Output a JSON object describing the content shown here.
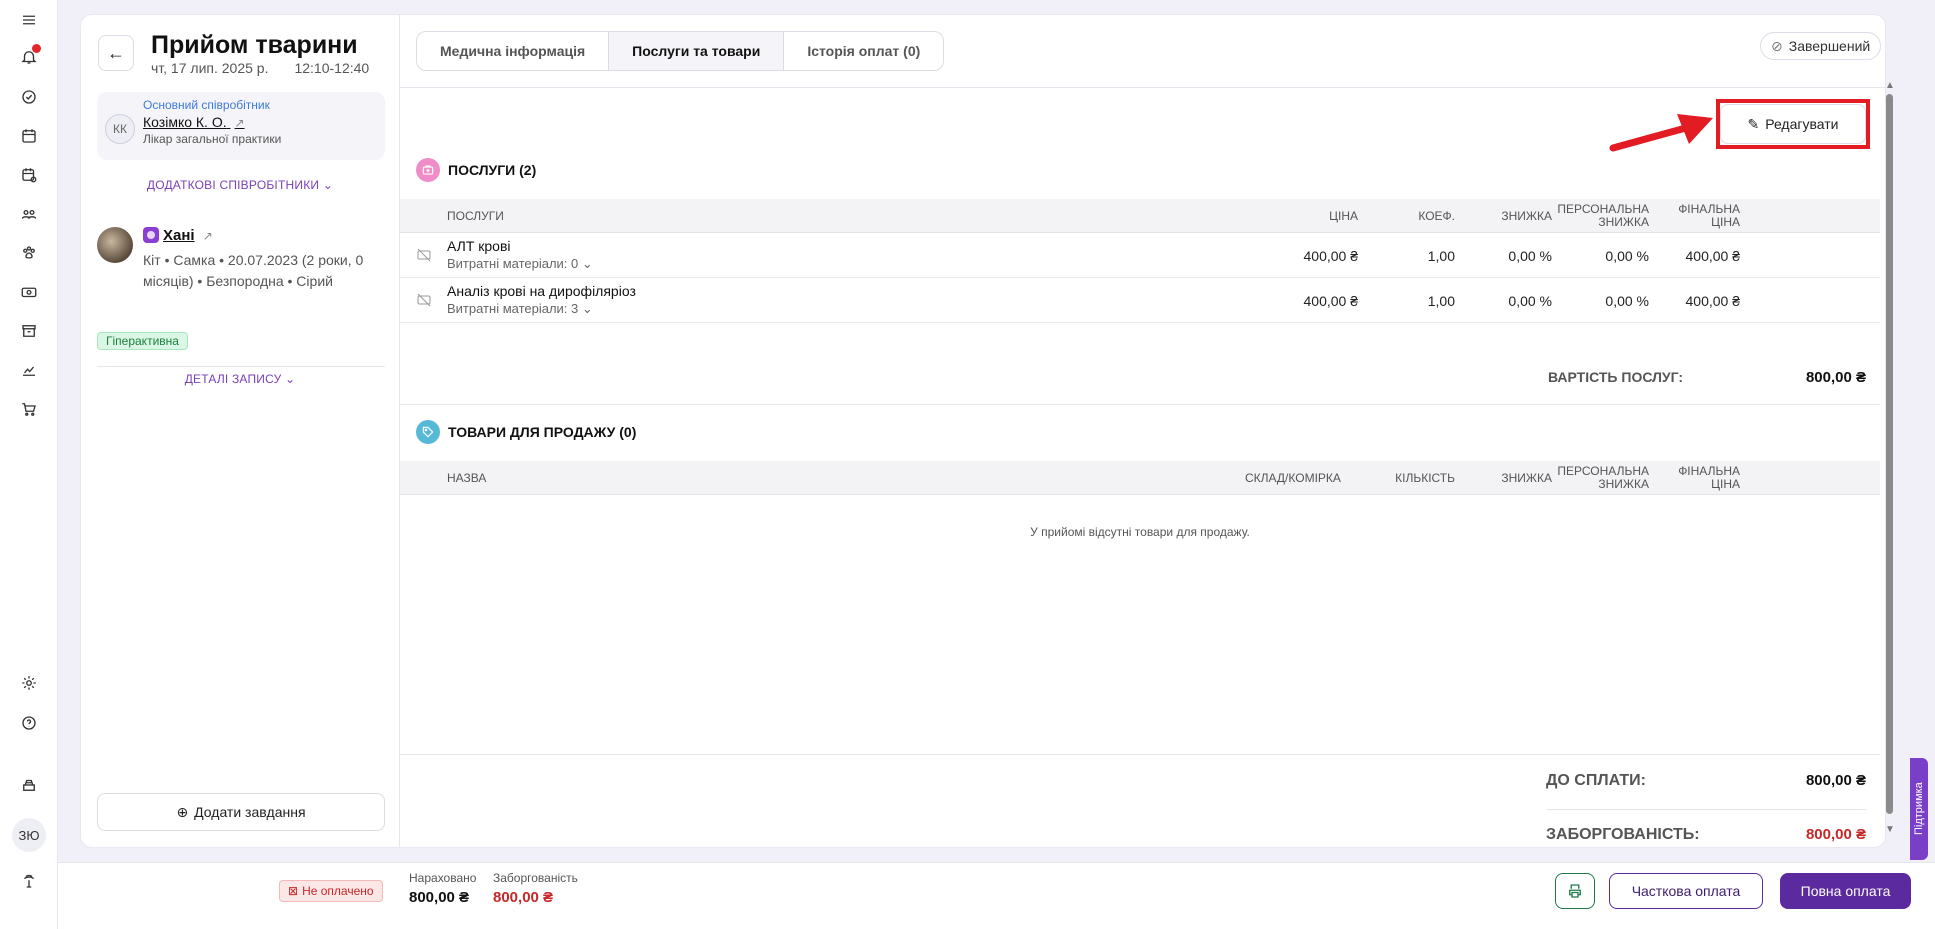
{
  "header": {
    "title": "Прийом тварини",
    "date": "чт, 17 лип. 2025 р.",
    "time": "12:10-12:40"
  },
  "staff": {
    "role_label": "Основний співробітник",
    "initials": "КК",
    "name": "Козімко К. О.",
    "position": "Лікар загальної практики",
    "additional_link": "ДОДАТКОВІ СПІВРОБІТНИКИ"
  },
  "pet": {
    "name": "Хані",
    "info": "Кіт • Самка • 20.07.2023 (2 роки, 0 місяців) • Безпородна • Сірий",
    "tag": "Гіперактивна",
    "details_link": "ДЕТАЛІ ЗАПИСУ"
  },
  "add_task_label": "Додати завдання",
  "tabs": [
    {
      "label": "Медична інформація"
    },
    {
      "label": "Послуги та товари"
    },
    {
      "label": "Історія оплат (0)"
    }
  ],
  "status": "Завершений",
  "edit_label": "Редагувати",
  "services": {
    "title": "ПОСЛУГИ (2)",
    "columns": [
      "ПОСЛУГИ",
      "ЦІНА",
      "КОЕФ.",
      "ЗНИЖКА",
      "ПЕРСОНАЛЬНА ЗНИЖКА",
      "ФІНАЛЬНА ЦІНА"
    ],
    "rows": [
      {
        "name": "АЛТ крові",
        "sub": "Витратні матеріали: 0",
        "price": "400,00 ₴",
        "coef": "1,00",
        "discount": "0,00 %",
        "personal": "0,00 %",
        "final": "400,00 ₴"
      },
      {
        "name": "Аналіз крові на дирофіляріоз",
        "sub": "Витратні матеріали: 3",
        "price": "400,00 ₴",
        "coef": "1,00",
        "discount": "0,00 %",
        "personal": "0,00 %",
        "final": "400,00 ₴"
      }
    ],
    "total_label": "ВАРТІСТЬ ПОСЛУГ:",
    "total_value": "800,00 ₴"
  },
  "goods": {
    "title": "ТОВАРИ ДЛЯ ПРОДАЖУ (0)",
    "columns": [
      "НАЗВА",
      "СКЛАД/КОМІРКА",
      "КІЛЬКІСТЬ",
      "ЗНИЖКА",
      "ПЕРСОНАЛЬНА ЗНИЖКА",
      "ФІНАЛЬНА ЦІНА"
    ],
    "empty": "У прийомі відсутні товари для продажу."
  },
  "summary": {
    "to_pay_label": "ДО СПЛАТИ:",
    "to_pay_value": "800,00 ₴",
    "debt_label": "ЗАБОРГОВАНІСТЬ:",
    "debt_value": "800,00 ₴"
  },
  "footer": {
    "status": "Не оплачено",
    "accrued_label": "Нараховано",
    "accrued_value": "800,00 ₴",
    "debt_label": "Заборгованість",
    "debt_value": "800,00 ₴",
    "partial_label": "Часткова оплата",
    "full_label": "Повна оплата"
  },
  "user_initials": "ЗЮ",
  "support_label": "Підтримка",
  "colors": {
    "accent": "#5b2a9e",
    "link_blue": "#3d7bd9",
    "debt_red": "#c62828",
    "highlight_red": "#e31b23",
    "services_icon": "#f08cc8",
    "goods_icon": "#56b9d6"
  }
}
